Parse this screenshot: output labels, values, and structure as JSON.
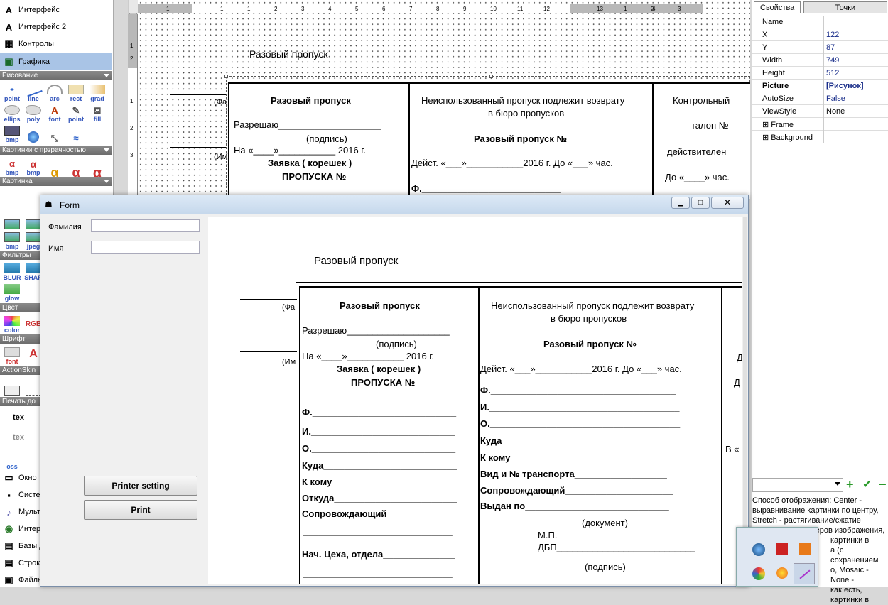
{
  "toolbox": {
    "items_top": [
      {
        "label": "Интерфейс",
        "icon": "A"
      },
      {
        "label": "Интерфейс 2",
        "icon": "A"
      },
      {
        "label": "Контролы",
        "icon": "▦"
      },
      {
        "label": "Графика",
        "icon": "▣"
      }
    ],
    "sections": {
      "draw": "Рисование",
      "alpha_images": "Картинки с прзрачностью",
      "images": "Картинка",
      "filters": "Фильтры",
      "color": "Цвет",
      "font": "Шрифт",
      "actionskin": "ActionSkin",
      "print": "Печать до"
    },
    "draw_tools": [
      "point",
      "line",
      "arc",
      "rect",
      "grad",
      "ellips",
      "poly",
      "font",
      "point",
      "fill",
      "bmp",
      "",
      "",
      ""
    ],
    "alpha_tools": [
      "bmp",
      "bmp",
      "",
      "",
      ""
    ],
    "image_tools": [
      "",
      "",
      "bmp",
      "jpeg"
    ],
    "filter_tools": [
      "BLUR",
      "SHAR",
      "glow"
    ],
    "color_tools": [
      "color",
      "RGB"
    ],
    "font_tools": [
      "font",
      "A"
    ],
    "print_tools": [
      "tex",
      "tex",
      "",
      "oss"
    ],
    "items_bottom": [
      {
        "label": "Окно",
        "icon": "▭"
      },
      {
        "label": "Систе",
        "icon": "▪"
      },
      {
        "label": "Мульт",
        "icon": "♪"
      },
      {
        "label": "Интер",
        "icon": "◉"
      },
      {
        "label": "Базы д",
        "icon": "▤"
      },
      {
        "label": "Строк",
        "icon": "▤"
      },
      {
        "label": "Файль",
        "icon": "▣"
      }
    ]
  },
  "ruler": {
    "top_ticks": [
      "1",
      "1",
      "1",
      "2",
      "3",
      "4",
      "5",
      "6",
      "7",
      "8",
      "9",
      "10",
      "11",
      "12",
      "13",
      "1",
      "2",
      "3",
      "4"
    ],
    "left_ticks": [
      "1",
      "2",
      "1",
      "2",
      "3"
    ]
  },
  "designer": {
    "title": "Разовый пропуск",
    "left_stub1": "(Фа",
    "left_stub2": "(Им",
    "col1": {
      "heading": "Разовый пропуск",
      "line1": "Разрешаю____________________",
      "line2": "(подпись)",
      "line3": "На «____»___________ 2016 г.",
      "line4": "Заявка ( корешек )",
      "line5": "ПРОПУСКА №"
    },
    "col2": {
      "heading1": "Неиспользованный пропуск подлежит возврату",
      "heading2": "в бюро пропусков",
      "line1": "Разовый пропуск №",
      "line2": "Дейст. «___»___________2016 г. До «___» час.",
      "line3": "Ф.___________________________"
    },
    "col3": {
      "line1": "Контрольный",
      "line2": "талон №",
      "line3": "действителен",
      "line4": "До «____» час."
    }
  },
  "properties": {
    "tabs": [
      "Свойства",
      "Точки"
    ],
    "rows": [
      {
        "key": "Name",
        "value": ""
      },
      {
        "key": "X",
        "value": "122"
      },
      {
        "key": "Y",
        "value": "87"
      },
      {
        "key": "Width",
        "value": "749"
      },
      {
        "key": "Height",
        "value": "512"
      },
      {
        "key": "Picture",
        "value": "[Рисунок]"
      },
      {
        "key": "AutoSize",
        "value": "False"
      },
      {
        "key": "ViewStyle",
        "value": "None"
      },
      {
        "key": "Frame",
        "value": ""
      },
      {
        "key": "Background",
        "value": ""
      }
    ],
    "help_lines": [
      "Способ отображения: Center -",
      "выравнивание картинки по центру,",
      "Stretch - растягивание/сжатие",
      "картинки до размеров изображения,",
      "картинки в",
      "а (с сохранением",
      "о, Mosaic -",
      "None -",
      "как есть,",
      "картинки в"
    ]
  },
  "form": {
    "title": "Form",
    "surname_label": "Фамилия",
    "name_label": "Имя",
    "printer_button": "Printer setting",
    "print_button": "Print",
    "doc": {
      "title": "Разовый пропуск",
      "left_stub1": "(Фа",
      "left_stub2": "(Им",
      "col1": {
        "heading": "Разовый пропуск",
        "line1": "Разрешаю____________________",
        "line2": "(подпись)",
        "line3": "На «____»___________ 2016 г.",
        "line4": "Заявка ( корешек )",
        "line5": "ПРОПУСКА №",
        "f": "Ф.____________________________",
        "i": "И.____________________________",
        "o": "О.____________________________",
        "kuda": "Куда__________________________",
        "kkomu": "К кому________________________",
        "otkuda": "Откуда________________________",
        "soprov": "Сопровождающий_____________",
        "blank": "_____________________________",
        "nach": "Нач. Цеха, отдела______________"
      },
      "col2": {
        "heading1": "Неиспользованный пропуск подлежит возврату",
        "heading2": "в бюро пропусков",
        "line1": "Разовый пропуск №",
        "line2": "Дейст. «___»___________2016 г. До «___» час.",
        "f": "Ф.____________________________________",
        "i": "И._____________________________________",
        "o": "О._____________________________________",
        "kuda": "Куда__________________________________",
        "kkomu": "К кому________________________________",
        "transport": "Вид и № транспорта__________________",
        "soprov": "Сопровождающий_____________________",
        "vydan": "Выдан по____________________________",
        "doc": "(документ)",
        "mp": "М.П.",
        "dbp": "ДБП___________________________",
        "sign": "(подпись)"
      },
      "col3": {
        "d1": "Д",
        "d2": "Д",
        "v": "В «"
      }
    }
  }
}
